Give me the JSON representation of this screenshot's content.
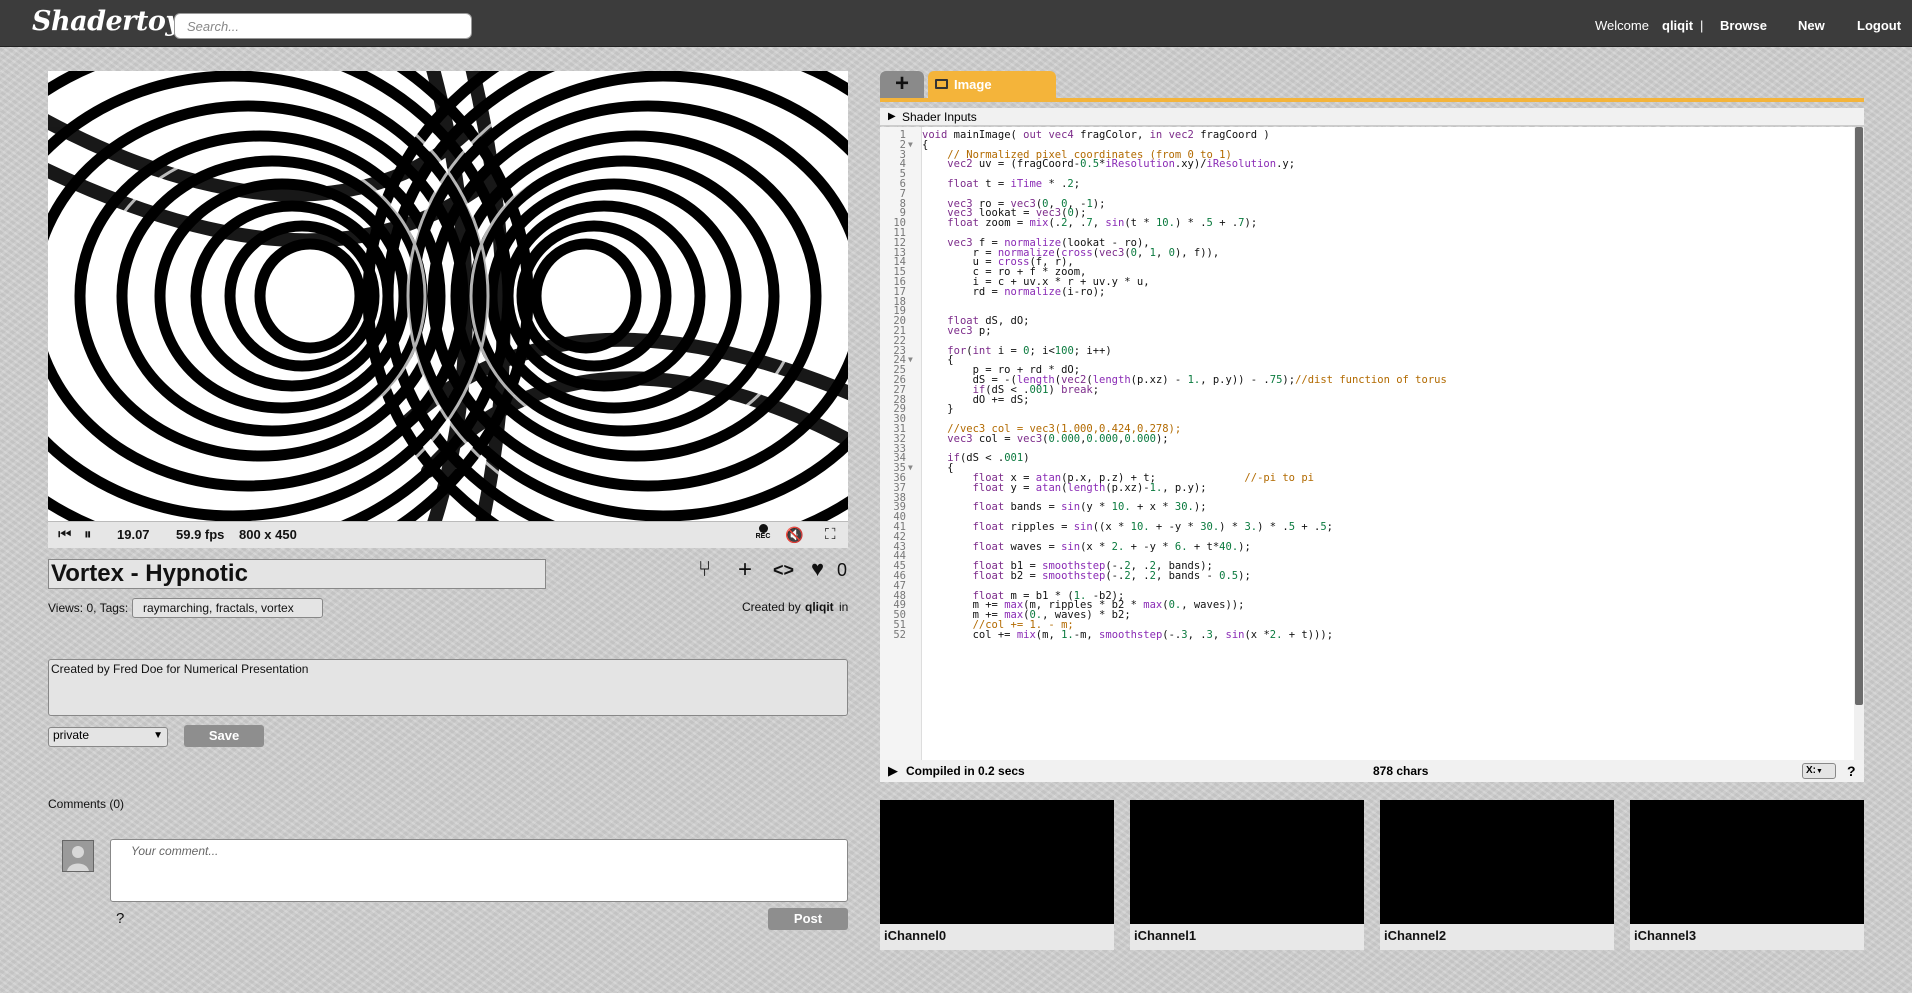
{
  "header": {
    "logo": "Shadertoy",
    "search_placeholder": "Search...",
    "welcome": "Welcome",
    "username": "qliqit",
    "separator": "|",
    "browse": "Browse",
    "new": "New",
    "logout": "Logout"
  },
  "player": {
    "time": "19.07",
    "fps": "59.9 fps",
    "resolution": "800 x 450",
    "rec_label": "REC",
    "icons": [
      "rewind-icon",
      "pause-icon",
      "record-icon",
      "volume-icon",
      "fullscreen-icon"
    ]
  },
  "shader": {
    "title": "Vortex - Hypnotic",
    "views_tags": "Views: 0, Tags:",
    "tags": "raymarching, fractals, vortex",
    "created_by_prefix": "Created by",
    "author": "qliqit",
    "created_suffix": "in",
    "likes": "0",
    "description": "Created by Fred Doe for Numerical Presentation",
    "privacy": "private",
    "save": "Save"
  },
  "comments": {
    "heading": "Comments (0)",
    "placeholder": "Your comment...",
    "help": "?",
    "post": "Post"
  },
  "editor": {
    "tab_add": "+",
    "tab_image": "Image",
    "shader_inputs": "Shader Inputs",
    "compiled": "Compiled in 0.2 secs",
    "chars": "878 chars",
    "font_size_select": "X:",
    "help": "?",
    "lines": [
      {
        "n": "1",
        "t": "void mainImage( out vec4 fragColor, in vec2 fragCoord )"
      },
      {
        "n": "2",
        "t": "{",
        "fold": true
      },
      {
        "n": "3",
        "t": "    // Normalized pixel coordinates (from 0 to 1)"
      },
      {
        "n": "4",
        "t": "    vec2 uv = (fragCoord-0.5*iResolution.xy)/iResolution.y;"
      },
      {
        "n": "5",
        "t": ""
      },
      {
        "n": "6",
        "t": "    float t = iTime * .2;"
      },
      {
        "n": "7",
        "t": ""
      },
      {
        "n": "8",
        "t": "    vec3 ro = vec3(0, 0, -1);"
      },
      {
        "n": "9",
        "t": "    vec3 lookat = vec3(0);"
      },
      {
        "n": "10",
        "t": "    float zoom = mix(.2, .7, sin(t * 10.) * .5 + .7);"
      },
      {
        "n": "11",
        "t": ""
      },
      {
        "n": "12",
        "t": "    vec3 f = normalize(lookat - ro),"
      },
      {
        "n": "13",
        "t": "        r = normalize(cross(vec3(0, 1, 0), f)),"
      },
      {
        "n": "14",
        "t": "        u = cross(f, r),"
      },
      {
        "n": "15",
        "t": "        c = ro + f * zoom,"
      },
      {
        "n": "16",
        "t": "        i = c + uv.x * r + uv.y * u,"
      },
      {
        "n": "17",
        "t": "        rd = normalize(i-ro);"
      },
      {
        "n": "18",
        "t": ""
      },
      {
        "n": "19",
        "t": ""
      },
      {
        "n": "20",
        "t": "    float dS, dO;"
      },
      {
        "n": "21",
        "t": "    vec3 p;"
      },
      {
        "n": "22",
        "t": ""
      },
      {
        "n": "23",
        "t": "    for(int i = 0; i<100; i++)"
      },
      {
        "n": "24",
        "t": "    {",
        "fold": true
      },
      {
        "n": "25",
        "t": "        p = ro + rd * dO;"
      },
      {
        "n": "26",
        "t": "        dS = -(length(vec2(length(p.xz) - 1., p.y)) - .75);//dist function of torus"
      },
      {
        "n": "27",
        "t": "        if(dS < .001) break;"
      },
      {
        "n": "28",
        "t": "        dO += dS;"
      },
      {
        "n": "29",
        "t": "    }"
      },
      {
        "n": "30",
        "t": ""
      },
      {
        "n": "31",
        "t": "    //vec3 col = vec3(1.000,0.424,0.278);"
      },
      {
        "n": "32",
        "t": "    vec3 col = vec3(0.000,0.000,0.000);"
      },
      {
        "n": "33",
        "t": ""
      },
      {
        "n": "34",
        "t": "    if(dS < .001)"
      },
      {
        "n": "35",
        "t": "    {",
        "fold": true
      },
      {
        "n": "36",
        "t": "        float x = atan(p.x, p.z) + t;              //-pi to pi"
      },
      {
        "n": "37",
        "t": "        float y = atan(length(p.xz)-1., p.y);"
      },
      {
        "n": "38",
        "t": ""
      },
      {
        "n": "39",
        "t": "        float bands = sin(y * 10. + x * 30.);"
      },
      {
        "n": "40",
        "t": ""
      },
      {
        "n": "41",
        "t": "        float ripples = sin((x * 10. + -y * 30.) * 3.) * .5 + .5;"
      },
      {
        "n": "42",
        "t": ""
      },
      {
        "n": "43",
        "t": "        float waves = sin(x * 2. + -y * 6. + t*40.);"
      },
      {
        "n": "44",
        "t": ""
      },
      {
        "n": "45",
        "t": "        float b1 = smoothstep(-.2, .2, bands);"
      },
      {
        "n": "46",
        "t": "        float b2 = smoothstep(-.2, .2, bands - 0.5);"
      },
      {
        "n": "47",
        "t": ""
      },
      {
        "n": "48",
        "t": "        float m = b1 * (1. -b2);"
      },
      {
        "n": "49",
        "t": "        m += max(m, ripples * b2 * max(0., waves));"
      },
      {
        "n": "50",
        "t": "        m += max(0., waves) * b2;"
      },
      {
        "n": "51",
        "t": "        //col += 1. - m;"
      },
      {
        "n": "52",
        "t": "        col += mix(m, 1.-m, smoothstep(-.3, .3, sin(x *2. + t)));"
      }
    ]
  },
  "channels": [
    "iChannel0",
    "iChannel1",
    "iChannel2",
    "iChannel3"
  ]
}
